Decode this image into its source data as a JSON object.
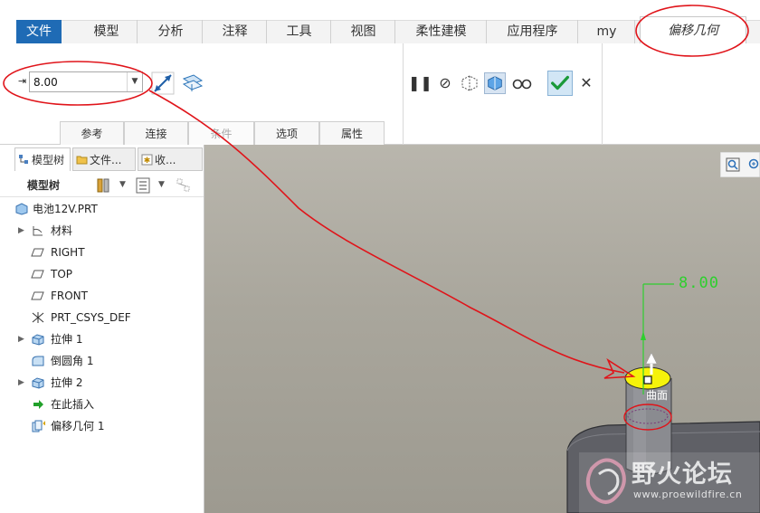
{
  "menu": {
    "tabs": [
      {
        "label": "文件"
      },
      {
        "label": "模型"
      },
      {
        "label": "分析"
      },
      {
        "label": "注释"
      },
      {
        "label": "工具"
      },
      {
        "label": "视图"
      },
      {
        "label": "柔性建模"
      },
      {
        "label": "应用程序"
      },
      {
        "label": "my"
      },
      {
        "label": "偏移几何"
      }
    ],
    "active_tab": "偏移几何"
  },
  "ribbon": {
    "offset_value": "8.00",
    "subtabs": [
      {
        "label": "参考"
      },
      {
        "label": "连接"
      },
      {
        "label": "条件"
      },
      {
        "label": "选项"
      },
      {
        "label": "属性"
      }
    ]
  },
  "left_panel": {
    "tabs": [
      {
        "label": "模型树"
      },
      {
        "label": "文件..."
      },
      {
        "label": "收..."
      }
    ],
    "header_label": "模型树",
    "tree": [
      {
        "label": "电池12V.PRT"
      },
      {
        "label": "材料"
      },
      {
        "label": "RIGHT"
      },
      {
        "label": "TOP"
      },
      {
        "label": "FRONT"
      },
      {
        "label": "PRT_CSYS_DEF"
      },
      {
        "label": "拉伸 1"
      },
      {
        "label": "倒圆角 1"
      },
      {
        "label": "拉伸 2"
      },
      {
        "label": "在此插入"
      },
      {
        "label": "偏移几何 1"
      }
    ]
  },
  "viewport": {
    "dimension_text": "8.00",
    "surface_label": "曲面"
  },
  "watermark": {
    "title": "野火论坛",
    "url": "www.proewildfire.cn"
  },
  "colors": {
    "file_tab": "#1f6bb5",
    "dimension_green": "#2ecf2e",
    "annotation_red": "#e0141a",
    "highlight_yellow": "#f6f20a",
    "ok_check": "#1b9a3a"
  }
}
